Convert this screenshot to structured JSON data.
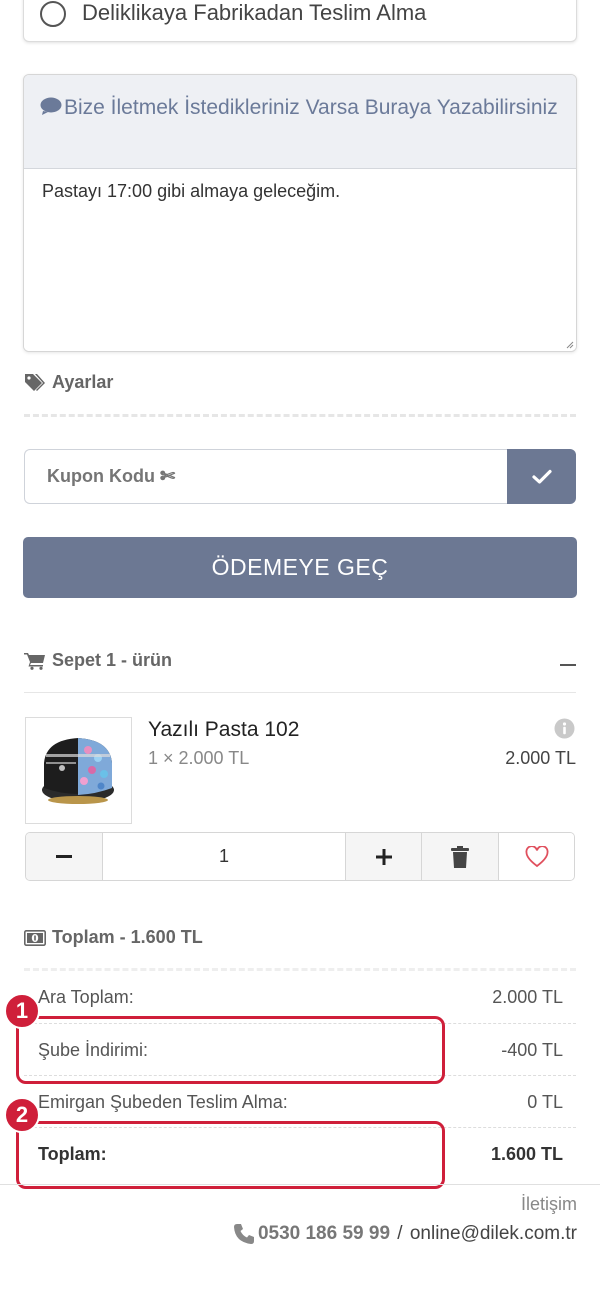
{
  "delivery_option": {
    "label": "Deliklikaya Fabrikadan Teslim Alma"
  },
  "message": {
    "title": "Bize İletmek İstedikleriniz Varsa Buraya Yazabilirsiniz",
    "value": "Pastayı 17:00 gibi almaya geleceğim."
  },
  "settings": {
    "label": "Ayarlar"
  },
  "coupon": {
    "placeholder": "Kupon Kodu ✄"
  },
  "checkout": {
    "button_label": "ÖDEMEYE GEÇ"
  },
  "cart": {
    "header": "Sepet 1 - ürün",
    "items": [
      {
        "name": "Yazılı Pasta 102",
        "qty_price": "1 × 2.000 TL",
        "total": "2.000 TL",
        "quantity": "1"
      }
    ]
  },
  "totals": {
    "header": "Toplam - 1.600 TL",
    "rows": [
      {
        "label": "Ara Toplam:",
        "value": "2.000 TL"
      },
      {
        "label": "Şube İndirimi:",
        "value": "-400 TL"
      },
      {
        "label": "Emirgan Şubeden Teslim Alma:",
        "value": "0 TL"
      },
      {
        "label": "Toplam:",
        "value": "1.600 TL"
      }
    ]
  },
  "annotations": {
    "badge1": "1",
    "badge2": "2"
  },
  "footer": {
    "contact_label": "İletişim",
    "phone": "0530 186 59 99",
    "separator": " / ",
    "email": "online@dilek.com.tr"
  },
  "colors": {
    "primary": "#6c7893",
    "annotation": "#cf1f3a",
    "header_bg": "#eef0f4"
  }
}
